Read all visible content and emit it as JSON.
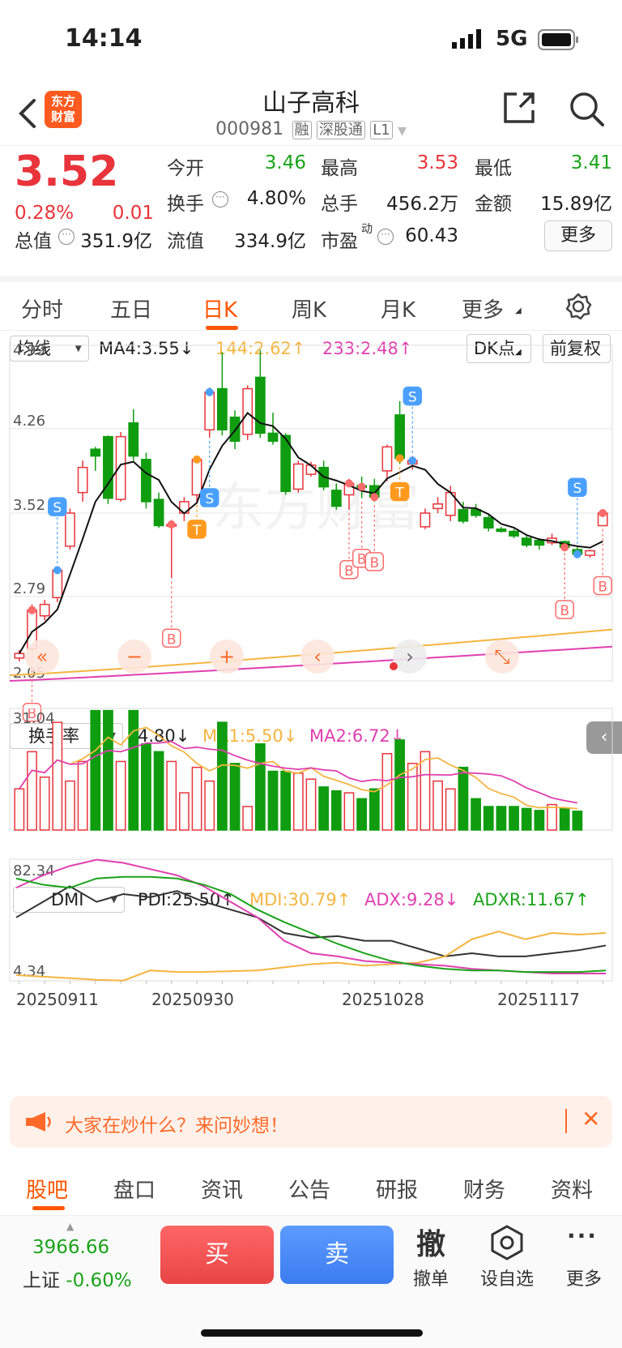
{
  "status": {
    "time": "14:14",
    "network": "5G"
  },
  "nav": {
    "logo": "东方\n财富",
    "title": "山子高科",
    "code": "000981",
    "tags": [
      "融",
      "深股通",
      "L1"
    ]
  },
  "quote": {
    "price": "3.52",
    "pct": "0.28%",
    "chg": "0.01",
    "fields": [
      {
        "label": "今开",
        "value": "3.46",
        "color": "#1aa31a"
      },
      {
        "label": "最高",
        "value": "3.53",
        "color": "#e8343a"
      },
      {
        "label": "最低",
        "value": "3.41",
        "color": "#1aa31a"
      },
      {
        "label": "换手",
        "value": "4.80%",
        "color": "#222"
      },
      {
        "label": "总手",
        "value": "456.2万",
        "color": "#222"
      },
      {
        "label": "金额",
        "value": "15.89亿",
        "color": "#222"
      },
      {
        "label": "总值",
        "value": "351.9亿",
        "color": "#222"
      },
      {
        "label": "流值",
        "value": "334.9亿",
        "color": "#222"
      },
      {
        "label": "市盈",
        "value": "60.43",
        "color": "#222"
      }
    ],
    "pe_sup": "动",
    "more": "更多"
  },
  "tabs": [
    "分时",
    "五日",
    "日K",
    "周K",
    "月K",
    "更多"
  ],
  "active_tab": "日K",
  "ma_bar": {
    "select": "均线",
    "ma4": "MA4:3.55",
    "ma144": "144:2.62",
    "ma233": "233:2.48",
    "dk": "DK点",
    "fq": "前复权"
  },
  "vol_bar": {
    "select": "换手率",
    "v": "4.80",
    "ma1": "MA1:5.50",
    "ma2": "MA2:6.72"
  },
  "dmi_bar": {
    "select": "DMI",
    "pdi": "PDI:25.50",
    "mdi": "MDI:30.79",
    "adx": "ADX:9.28",
    "adxr": "ADXR:11.67"
  },
  "colors": {
    "up": "#e8343a",
    "down": "#0f9d0f",
    "ma4": "#111111",
    "ma144": "#f5b540",
    "ma233": "#e040b0",
    "accent": "#ff5500"
  },
  "chart_data": [
    {
      "type": "candlestick",
      "ylabels": [
        "4.99",
        "4.26",
        "3.52",
        "2.79",
        "2.05"
      ],
      "ylim": [
        2.05,
        4.99
      ],
      "candles": [
        [
          2.25,
          2.29,
          2.32,
          2.22
        ],
        [
          2.33,
          2.67,
          2.72,
          2.3
        ],
        [
          2.62,
          2.72,
          2.76,
          2.58
        ],
        [
          2.78,
          3.02,
          3.05,
          2.74
        ],
        [
          3.23,
          3.52,
          3.56,
          3.2
        ],
        [
          3.7,
          3.92,
          3.98,
          3.62
        ],
        [
          4.08,
          4.02,
          4.1,
          3.89
        ],
        [
          4.19,
          3.65,
          4.2,
          3.6
        ],
        [
          3.64,
          4.19,
          4.23,
          3.62
        ],
        [
          4.31,
          4.02,
          4.43,
          3.98
        ],
        [
          3.99,
          3.62,
          4.05,
          3.56
        ],
        [
          3.64,
          3.41,
          3.7,
          3.39
        ],
        [
          3.42,
          3.42,
          3.46,
          2.95
        ],
        [
          3.52,
          3.62,
          3.66,
          3.45
        ],
        [
          3.68,
          3.99,
          4.0,
          3.62
        ],
        [
          4.25,
          4.58,
          4.62,
          4.18
        ],
        [
          4.61,
          4.25,
          4.93,
          4.2
        ],
        [
          4.36,
          4.15,
          4.42,
          4.08
        ],
        [
          4.21,
          4.61,
          4.64,
          4.16
        ],
        [
          4.71,
          4.22,
          4.95,
          4.18
        ],
        [
          4.22,
          4.15,
          4.4,
          4.12
        ],
        [
          4.2,
          3.71,
          4.22,
          3.68
        ],
        [
          3.73,
          3.95,
          3.98,
          3.7
        ],
        [
          3.86,
          3.94,
          3.97,
          3.84
        ],
        [
          3.92,
          3.75,
          3.98,
          3.72
        ],
        [
          3.72,
          3.58,
          3.78,
          3.55
        ],
        [
          3.68,
          3.78,
          3.82,
          3.55
        ],
        [
          3.76,
          3.75,
          3.84,
          3.65
        ],
        [
          3.76,
          3.66,
          3.82,
          3.62
        ],
        [
          3.89,
          4.1,
          4.12,
          3.8
        ],
        [
          4.38,
          4.0,
          4.5,
          3.95
        ],
        [
          3.95,
          3.98,
          4.02,
          3.9
        ],
        [
          3.4,
          3.52,
          3.56,
          3.38
        ],
        [
          3.56,
          3.6,
          3.66,
          3.52
        ],
        [
          3.5,
          3.7,
          3.76,
          3.45
        ],
        [
          3.55,
          3.45,
          3.62,
          3.43
        ],
        [
          3.55,
          3.5,
          3.6,
          3.48
        ],
        [
          3.48,
          3.39,
          3.5,
          3.36
        ],
        [
          3.38,
          3.36,
          3.4,
          3.35
        ],
        [
          3.36,
          3.32,
          3.38,
          3.3
        ],
        [
          3.3,
          3.24,
          3.32,
          3.22
        ],
        [
          3.28,
          3.24,
          3.3,
          3.2
        ],
        [
          3.26,
          3.3,
          3.34,
          3.24
        ],
        [
          3.27,
          3.22,
          3.28,
          3.2
        ],
        [
          3.2,
          3.16,
          3.22,
          3.13
        ],
        [
          3.15,
          3.19,
          3.2,
          3.13
        ],
        [
          3.41,
          3.52,
          3.53,
          3.41
        ]
      ]
    },
    {
      "type": "bar",
      "title": "换手率",
      "ylabels": [
        "31.04"
      ],
      "values": [
        10.5,
        20,
        13.5,
        27.5,
        12.5,
        17.5,
        30.5,
        30.5,
        17.5,
        30.5,
        22,
        20,
        17.5,
        9.5,
        16,
        12.5,
        27.5,
        17,
        6,
        22,
        15,
        15,
        14.5,
        13,
        11,
        10,
        9.5,
        8,
        10.5,
        19.5,
        23,
        17,
        20,
        12.5,
        10.5,
        16,
        8,
        6,
        6,
        6,
        5.5,
        5,
        6.5,
        5.5,
        4.8
      ]
    },
    {
      "type": "line",
      "title": "DMI",
      "ylabels": [
        "82.34",
        "4.34"
      ]
    }
  ],
  "xlabels": [
    "20250911",
    "20250930",
    "20251028",
    "20251117"
  ],
  "watermark": "东方财富",
  "banner": {
    "text": "大家在炒什么？来问妙想！"
  },
  "bottom_tabs": [
    "股吧",
    "盘口",
    "资讯",
    "公告",
    "研报",
    "财务",
    "资料"
  ],
  "footer": {
    "index_value": "3966.66",
    "index_name": "上证",
    "index_pct": "-0.60%",
    "buy": "买",
    "sell": "卖",
    "cancel_icon": "撤",
    "cancel": "撤单",
    "watch": "设自选",
    "more": "更多"
  }
}
